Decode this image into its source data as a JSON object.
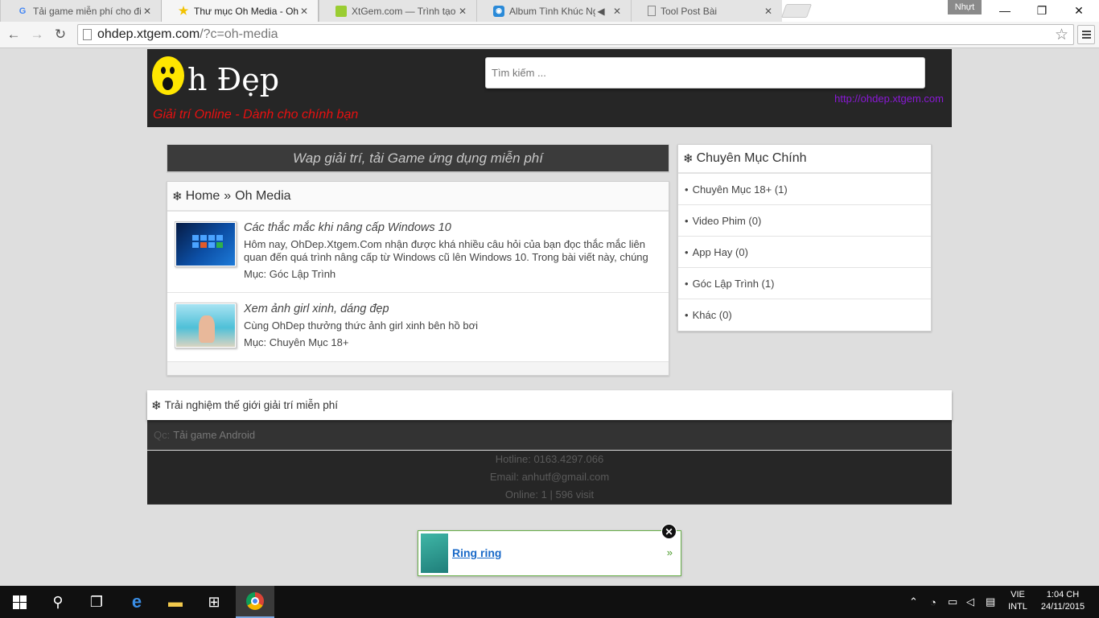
{
  "browser": {
    "tabs": [
      {
        "title": "Tải game miễn phí cho điệ",
        "icon": "google-icon",
        "active": false
      },
      {
        "title": "Thư mục Oh Media - OhĐ",
        "icon": "star-icon",
        "active": true
      },
      {
        "title": "XtGem.com — Trình tạo w",
        "icon": "xtgem-icon",
        "active": false
      },
      {
        "title": "Album Tình Khúc Nguy",
        "icon": "music-icon",
        "active": false
      },
      {
        "title": "Tool Post Bài",
        "icon": "page-icon",
        "active": false
      }
    ],
    "user_badge": "Nhựt",
    "url_host": "ohdep.xtgem.com",
    "url_path": "/?c=oh-media"
  },
  "header": {
    "logo_text": "h Đẹp",
    "slogan": "Giải trí Online - Dành cho chính bạn",
    "search_placeholder": "Tìm kiếm ...",
    "site_url": "http://ohdep.xtgem.com"
  },
  "main": {
    "banner": "Wap giải trí, tải Game ứng dụng miễn phí",
    "breadcrumb": {
      "home": "Home",
      "separator": "»",
      "current": "Oh Media"
    },
    "posts": [
      {
        "title": "Các thắc mắc khi nâng cấp Windows 10",
        "excerpt": "Hôm nay, OhDep.Xtgem.Com nhận được khá nhiều câu hỏi của bạn đọc thắc mắc liên quan đến quá trình nâng cấp từ Windows cũ lên Windows 10. Trong bài viết này, chúng",
        "category": "Mục: Góc Lập Trình"
      },
      {
        "title": "Xem ảnh girl xinh, dáng đẹp",
        "excerpt": "Cùng OhDep thưởng thức ảnh girl xinh bên hồ bơi",
        "category": "Mục: Chuyên Mục 18+"
      }
    ]
  },
  "sidebar": {
    "title": "Chuyên Mục Chính",
    "items": [
      {
        "label": "Chuyên Mục 18+ (1)"
      },
      {
        "label": "Video Phim (0)"
      },
      {
        "label": "App Hay (0)"
      },
      {
        "label": "Góc Lập Trình (1)"
      },
      {
        "label": "Khác (0)"
      }
    ]
  },
  "footer": {
    "title": "Trải nghiệm thế giới giải trí miễn phí",
    "ad_prefix": "Qc:",
    "ad_link": "Tải game Android",
    "hotline": "Hotline: 0163.4297.066",
    "email": "Email: anhutf@gmail.com",
    "stats": "Online: 1 | 596 visit"
  },
  "popup": {
    "link": "Ring ring",
    "arrow": "»"
  },
  "taskbar": {
    "lang_top": "VIE",
    "lang_bottom": "INTL",
    "time": "1:04 CH",
    "date": "24/11/2015"
  }
}
